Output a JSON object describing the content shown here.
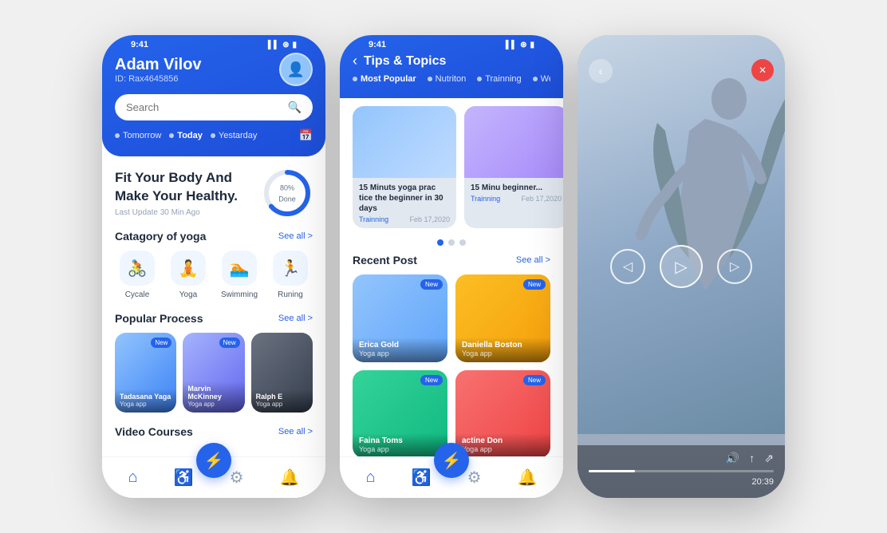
{
  "phone1": {
    "status": {
      "time": "9:41",
      "icons": "▌▌ ⊛ 🔋"
    },
    "user": {
      "name": "Adam Vilov",
      "id": "ID: Rax4645856"
    },
    "search": {
      "placeholder": "Search"
    },
    "datePills": [
      {
        "label": "Tomorrow",
        "active": false
      },
      {
        "label": "Today",
        "active": true
      },
      {
        "label": "Yestarday",
        "active": false
      }
    ],
    "fitness": {
      "title": "Fit Your Body And Make Your Healthy.",
      "lastUpdate": "Last Update 30 Min Ago",
      "progress": 80,
      "progressLabel": "80%",
      "progressSub": "Done"
    },
    "category": {
      "title": "Catagory of yoga",
      "seeAll": "See all >",
      "items": [
        {
          "label": "Cycale",
          "icon": "🚴"
        },
        {
          "label": "Yoga",
          "icon": "🧘"
        },
        {
          "label": "Swimming",
          "icon": "🏊"
        },
        {
          "label": "Runing",
          "icon": "🏃"
        }
      ]
    },
    "popular": {
      "title": "Popular Process",
      "seeAll": "See all >",
      "items": [
        {
          "name": "Tadasana Yaga",
          "sub": "Yoga app",
          "badge": "New",
          "style": "p1"
        },
        {
          "name": "Marvin McKinney",
          "sub": "Yoga app",
          "badge": "New",
          "style": "p2"
        },
        {
          "name": "Ralph E",
          "sub": "Yoga app",
          "badge": "",
          "style": "p3"
        }
      ]
    },
    "videoCourses": {
      "title": "Video Courses",
      "seeAll": "See all >"
    },
    "nav": {
      "items": [
        {
          "icon": "⌂",
          "active": true
        },
        {
          "icon": "♿",
          "active": false
        },
        {
          "icon": "⚙",
          "active": false
        },
        {
          "icon": "🔔",
          "active": false
        }
      ],
      "fabIcon": "⚡"
    }
  },
  "phone2": {
    "status": {
      "time": "9:41"
    },
    "header": {
      "backLabel": "‹",
      "title": "Tips & Topics"
    },
    "filters": [
      {
        "label": "Most Popular",
        "active": true
      },
      {
        "label": "Nutriton",
        "active": false
      },
      {
        "label": "Trainning",
        "active": false
      },
      {
        "label": "Weight lo...",
        "active": false
      }
    ],
    "featured": {
      "cards": [
        {
          "title": "15 Minuts yoga prac tice the beginner in 30 days",
          "tag": "Trainning",
          "date": "Feb 17,2020",
          "style": "fc1"
        },
        {
          "title": "15 Minu beginner...",
          "tag": "Trainning",
          "date": "Feb 17,2020",
          "style": "fc2"
        }
      ],
      "dots": [
        true,
        false,
        false
      ]
    },
    "recent": {
      "title": "Recent Post",
      "seeAll": "See all >",
      "items": [
        {
          "name": "Erica Gold",
          "sub": "Yoga app",
          "badge": "New",
          "style": "r1"
        },
        {
          "name": "Daniella Boston",
          "sub": "Yoga app",
          "badge": "New",
          "style": "r2"
        },
        {
          "name": "Faina Toms",
          "sub": "Yoga app",
          "badge": "New",
          "style": "r3"
        },
        {
          "name": "actine Don",
          "sub": "Yoga app",
          "badge": "New",
          "style": "r4"
        }
      ]
    },
    "nav": {
      "items": [
        {
          "icon": "⌂",
          "active": true
        },
        {
          "icon": "♿",
          "active": false
        },
        {
          "icon": "⚙",
          "active": false
        },
        {
          "icon": "🔔",
          "active": false
        }
      ],
      "fabIcon": "⚡"
    }
  },
  "phone3": {
    "status": {
      "time": ""
    },
    "controls": {
      "prev": "◁",
      "play": "▷",
      "next": "▷"
    },
    "metaIcons": [
      "🔊",
      "↑",
      "⇗"
    ],
    "video": {
      "progress": 25,
      "time": "20:39"
    }
  }
}
